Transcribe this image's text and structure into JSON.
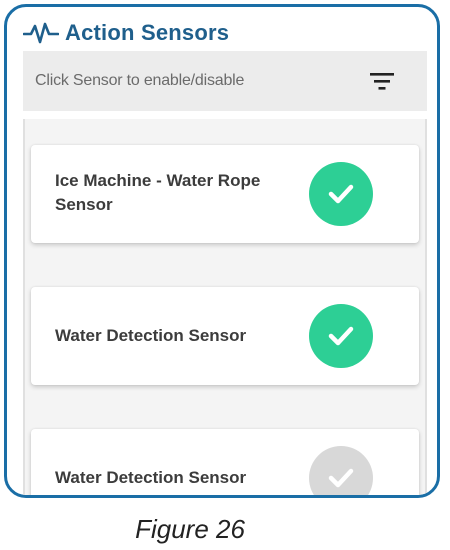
{
  "header": {
    "icon": "pulse-icon",
    "title": "Action Sensors",
    "title_color": "#1f5f8c"
  },
  "toolbar": {
    "hint": "Click Sensor to enable/disable",
    "filter_icon": "filter-icon"
  },
  "sensors": [
    {
      "label_line1": "Ice Machine - Water Rope",
      "label_line2": "Sensor",
      "enabled": true
    },
    {
      "label_line1": "Water Detection Sensor",
      "label_line2": "",
      "enabled": true
    },
    {
      "label_line1": "Water Detection Sensor",
      "label_line2": "",
      "enabled": false
    }
  ],
  "colors": {
    "frame": "#1a6ea6",
    "enabled_check": "#2dcf95",
    "disabled_check": "#d8d8d8"
  },
  "caption": "Figure 26"
}
